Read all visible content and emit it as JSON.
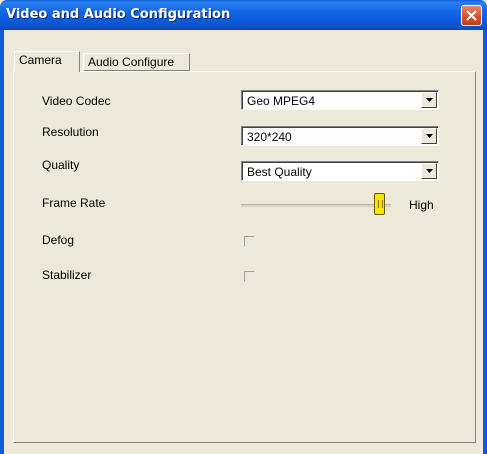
{
  "window": {
    "title": "Video and Audio Configuration"
  },
  "tabs": [
    {
      "label": "Camera",
      "active": true
    },
    {
      "label": "Audio Configure",
      "active": false
    }
  ],
  "camera": {
    "video_codec": {
      "label": "Video Codec",
      "value": "Geo MPEG4"
    },
    "resolution": {
      "label": "Resolution",
      "value": "320*240"
    },
    "quality": {
      "label": "Quality",
      "value": "Best Quality"
    },
    "frame_rate": {
      "label": "Frame Rate",
      "level": 1.0,
      "max_label": "High"
    },
    "defog": {
      "label": "Defog",
      "checked": false
    },
    "stabilizer": {
      "label": "Stabilizer",
      "checked": false
    }
  },
  "colors": {
    "titlebar": "#0a5fd8",
    "close": "#d95a3a",
    "face": "#ECE9D8",
    "thumb": "#f6e300"
  },
  "icons": {
    "close": "close-icon",
    "dropdown": "chevron-down-icon"
  }
}
